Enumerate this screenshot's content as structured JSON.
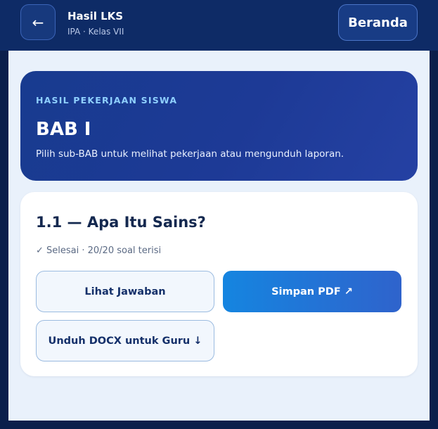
{
  "header": {
    "back_icon": "←",
    "title": "Hasil LKS",
    "subtitle": "IPA · Kelas VII",
    "home_label": "Beranda"
  },
  "hero": {
    "eyebrow": "HASIL PEKERJAAN SISWA",
    "title": "BAB I",
    "description": "Pilih sub-BAB untuk melihat pekerjaan atau mengunduh laporan."
  },
  "card": {
    "title": "1.1 — Apa Itu Sains?",
    "status": "✓ Selesai · 20/20 soal terisi",
    "view_label": "Lihat Jawaban",
    "pdf_label": "Simpan PDF ↗",
    "docx_label": "Unduh DOCX untuk Guru ↓"
  },
  "colors": {
    "background": "#0b1f4b",
    "topbar": "#0e2b66",
    "content": "#e9f1fb",
    "hero": "#1d3a96",
    "eyebrow": "#8fd0ff",
    "primary_button": "#1585e0"
  }
}
